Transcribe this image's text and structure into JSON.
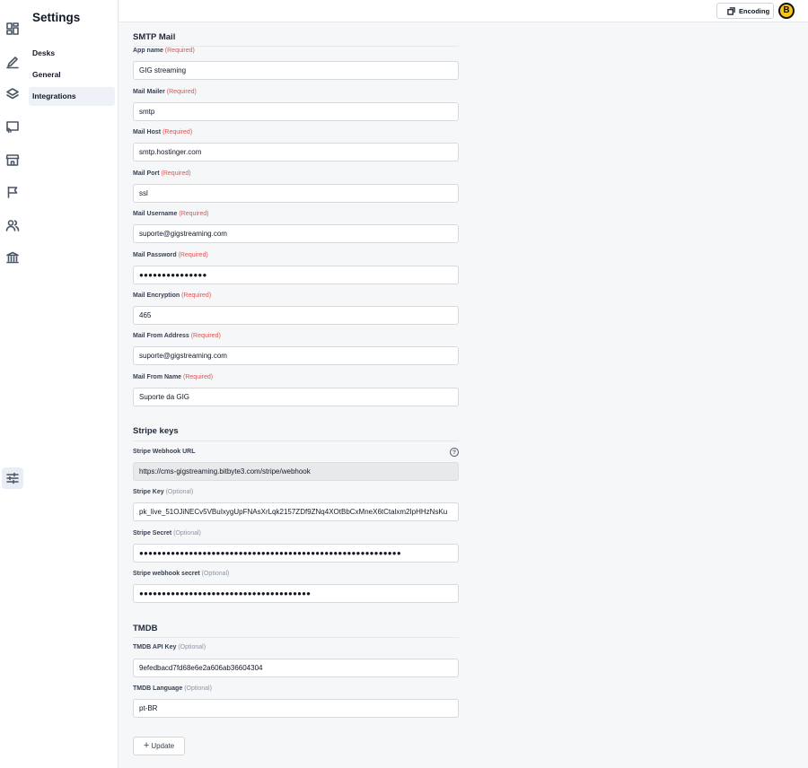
{
  "nav": {
    "title": "Settings",
    "items": [
      {
        "label": "Desks"
      },
      {
        "label": "General"
      },
      {
        "label": "Integrations"
      }
    ]
  },
  "rail_icons": [
    "dashboard-icon",
    "pencil-icon",
    "layers-icon",
    "cast-icon",
    "storefront-icon",
    "flag-icon",
    "users-icon",
    "bank-icon",
    "sliders-icon"
  ],
  "topbar": {
    "encoding_label": "Encoding",
    "avatar_letter": "B"
  },
  "smtp": {
    "title": "SMTP Mail",
    "fields": [
      {
        "label": "App name",
        "tag": "(Required)",
        "value": "GIG streaming"
      },
      {
        "label": "Mail Mailer",
        "tag": "(Required)",
        "value": "smtp"
      },
      {
        "label": "Mail Host",
        "tag": "(Required)",
        "value": "smtp.hostinger.com"
      },
      {
        "label": "Mail Port",
        "tag": "(Required)",
        "value": "ssl"
      },
      {
        "label": "Mail Username",
        "tag": "(Required)",
        "value": "suporte@gigstreaming.com"
      },
      {
        "label": "Mail Password",
        "tag": "(Required)",
        "value": "●●●●●●●●●●●●●●●"
      },
      {
        "label": "Mail Encryption",
        "tag": "(Required)",
        "value": "465"
      },
      {
        "label": "Mail From Address",
        "tag": "(Required)",
        "value": "suporte@gigstreaming.com"
      },
      {
        "label": "Mail From Name",
        "tag": "(Required)",
        "value": "Suporte da GIG"
      }
    ]
  },
  "stripe": {
    "title": "Stripe keys",
    "fields": [
      {
        "label": "Stripe Webhook URL",
        "tag": "",
        "value": "https://cms-gigstreaming.bitbyte3.com/stripe/webhook"
      },
      {
        "label": "Stripe Key",
        "tag": "(Optional)",
        "value": "pk_live_51OJiNECv5VBuIxygUpFNAsXrLqk2157ZDf9ZNq4XOtBbCxMneX6tCtalxm2IpHHzNsKu"
      },
      {
        "label": "Stripe Secret",
        "tag": "(Optional)",
        "value": "●●●●●●●●●●●●●●●●●●●●●●●●●●●●●●●●●●●●●●●●●●●●●●●●●●●●●●●●●●"
      },
      {
        "label": "Stripe webhook secret",
        "tag": "(Optional)",
        "value": "●●●●●●●●●●●●●●●●●●●●●●●●●●●●●●●●●●●●●●"
      }
    ],
    "help_glyph": "?"
  },
  "tmdb": {
    "title": "TMDB",
    "fields": [
      {
        "label": "TMDB API Key",
        "tag": "(Optional)",
        "value": "9efedbacd7fd68e6e2a606ab36604304"
      },
      {
        "label": "TMDB Language",
        "tag": "(Optional)",
        "value": "pt-BR"
      }
    ]
  },
  "actions": {
    "update_label": "Update",
    "update_glyph": "+"
  }
}
